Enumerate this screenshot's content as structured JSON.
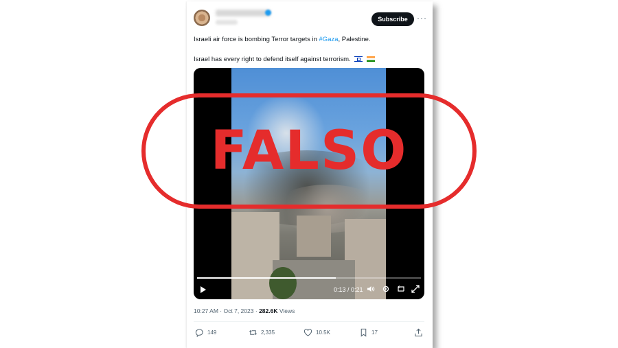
{
  "post": {
    "subscribe_label": "Subscribe",
    "text_line1_prefix": "Israeli air force is bombing Terror targets in ",
    "hashtag": "#Gaza",
    "text_line1_suffix": ", Palestine.",
    "text_line2": "Israel has every right to defend itself against terrorism.",
    "flags": [
      "Israel flag",
      "India flag"
    ]
  },
  "video": {
    "time": "0:13 / 0:21",
    "progress": 0.62,
    "icons": [
      "play-icon",
      "volume-icon",
      "settings-icon",
      "repost-video-icon",
      "fullscreen-icon"
    ]
  },
  "meta": {
    "time": "10:27 AM",
    "dot": "·",
    "date": "Oct 7, 2023",
    "views_count": "282.6K",
    "views_label": "Views"
  },
  "actions": {
    "replies": "149",
    "reposts": "2,335",
    "likes": "10.5K",
    "bookmarks": "17"
  },
  "stamp": {
    "label": "FALSO",
    "color": "#e52c2c"
  },
  "colors": {
    "accent": "#1d9bf0",
    "text": "#0f1419",
    "muted": "#536471"
  }
}
